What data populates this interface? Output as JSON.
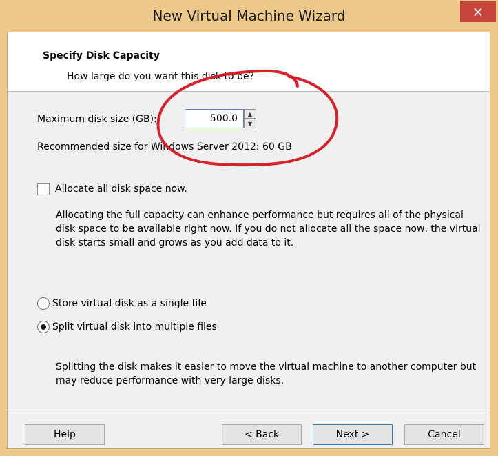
{
  "window": {
    "title": "New Virtual Machine Wizard",
    "close_symbol": "×",
    "colors": {
      "titlebar": "#ecc98a",
      "close": "#c7443b",
      "annotation": "#d8212b"
    }
  },
  "header": {
    "title": "Specify Disk Capacity",
    "subtitle": "How large do you want this disk to be?"
  },
  "disk": {
    "label": "Maximum disk size (GB):",
    "value": "500.0",
    "spinner_up_icon": "up-arrow-icon",
    "spinner_down_icon": "down-arrow-icon",
    "recommended_text": "Recommended size for Windows Server 2012: 60 GB"
  },
  "allocate": {
    "label": "Allocate all disk space now.",
    "checked": false,
    "description": "Allocating the full capacity can enhance performance but requires all of the physical disk space to be available right now. If you do not allocate all the space now, the virtual disk starts small and grows as you add data to it."
  },
  "storage": {
    "option_single": "Store virtual disk as a single file",
    "option_multiple": "Split virtual disk into multiple files",
    "selected": "multiple",
    "description": "Splitting the disk makes it easier to move the virtual machine to another computer but may reduce performance with very large disks."
  },
  "buttons": {
    "help": "Help",
    "back": "< Back",
    "next": "Next >",
    "cancel": "Cancel"
  }
}
